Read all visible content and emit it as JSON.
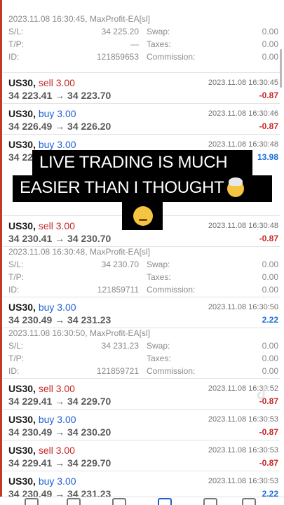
{
  "first_detail": {
    "header": "2023.11.08 16:30:45, MaxProfit-EA[sl]",
    "sl_label": "S/L:",
    "sl_value": "34 225.20",
    "tp_label": "T/P:",
    "tp_value": "—",
    "id_label": "ID:",
    "id_value": "121859653",
    "swap_label": "Swap:",
    "swap_value": "0.00",
    "taxes_label": "Taxes:",
    "taxes_value": "0.00",
    "commission_label": "Commission:",
    "commission_value": "0.00"
  },
  "trades": [
    {
      "symbol": "US30,",
      "side": "sell 3.00",
      "prices": "34 223.41 → 34 223.70",
      "time": "2023.11.08 16:30:45",
      "profit": "-0.87"
    },
    {
      "symbol": "US30,",
      "side": "buy 3.00",
      "prices": "34 226.49 → 34 226.20",
      "time": "2023.11.08 16:30:46",
      "profit": "-0.87"
    },
    {
      "symbol": "US30,",
      "side": "buy 3.00",
      "prices": "34 227.49 → 34 232.15",
      "time": "2023.11.08 16:30:48",
      "profit": "13.98"
    },
    {
      "symbol": "US30,",
      "side": "sell 3.00",
      "prices": "34 230.41 → 34 230.70",
      "time": "2023.11.08 16:30:48",
      "profit": "-0.87"
    },
    {
      "symbol": "US30,",
      "side": "buy 3.00",
      "prices": "34 230.49 → 34 231.23",
      "time": "2023.11.08 16:30:50",
      "profit": "2.22"
    },
    {
      "symbol": "US30,",
      "side": "sell 3.00",
      "prices": "34 229.41 → 34 229.70",
      "time": "2023.11.08 16:30:52",
      "profit": "-0.87"
    },
    {
      "symbol": "US30,",
      "side": "buy 3.00",
      "prices": "34 230.49 → 34 230.20",
      "time": "2023.11.08 16:30:53",
      "profit": "-0.87"
    },
    {
      "symbol": "US30,",
      "side": "sell 3.00",
      "prices": "34 229.41 → 34 229.70",
      "time": "2023.11.08 16:30:53",
      "profit": "-0.87"
    },
    {
      "symbol": "US30,",
      "side": "buy 3.00",
      "prices": "34 230.49 → 34 231.23",
      "time": "2023.11.08 16:30:53",
      "profit": "2.22"
    }
  ],
  "details": [
    {
      "header": "2023.11.08 16:30:48, MaxProfit-EA[sl]",
      "sl_label": "S/L:",
      "sl_value": "34 230.70",
      "tp_label": "T/P:",
      "tp_value": "",
      "id_label": "ID:",
      "id_value": "121859711",
      "swap_label": "Swap:",
      "swap_value": "0.00",
      "taxes_label": "Taxes:",
      "taxes_value": "0.00",
      "commission_label": "Commission:",
      "commission_value": "0.00"
    },
    {
      "header": "2023.11.08 16:30:50, MaxProfit-EA[sl]",
      "sl_label": "S/L:",
      "sl_value": "34 231.23",
      "tp_label": "T/P:",
      "tp_value": "",
      "id_label": "ID:",
      "id_value": "121859721",
      "swap_label": "Swap:",
      "swap_value": "0.00",
      "taxes_label": "Taxes:",
      "taxes_value": "0.00",
      "commission_label": "Commission:",
      "commission_value": "0.00"
    }
  ],
  "caption": {
    "line1": "LIVE TRADING IS MUCH",
    "line2": "EASIER THAN I THOUGHT",
    "emoji1": "exploding-head-emoji",
    "emoji2": "thinking-face-emoji"
  },
  "colors": {
    "sell": "#c62828",
    "buy": "#1e60d4",
    "negative": "#c62828",
    "positive": "#1e6fd9"
  }
}
